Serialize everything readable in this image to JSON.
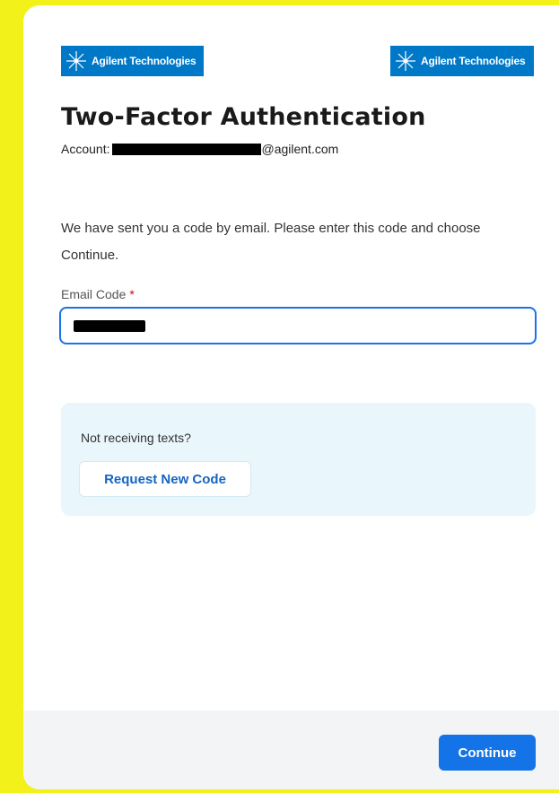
{
  "brand": {
    "logo_text": "Agilent Technologies",
    "logo_color": "#0078c8"
  },
  "header": {
    "title": "Two-Factor Authentication",
    "account_label": "Account:",
    "account_email_suffix": "@agilent.com"
  },
  "main": {
    "instructions": "We have sent you a code by email. Please enter this code and choose Continue.",
    "email_code_label": "Email Code",
    "required_marker": "*"
  },
  "help": {
    "text": "Not receiving texts?",
    "request_button_label": "Request New Code"
  },
  "footer": {
    "continue_label": "Continue"
  },
  "colors": {
    "accent": "#1473e6",
    "help_bg": "#e9f6fc",
    "required": "#d0021b"
  }
}
